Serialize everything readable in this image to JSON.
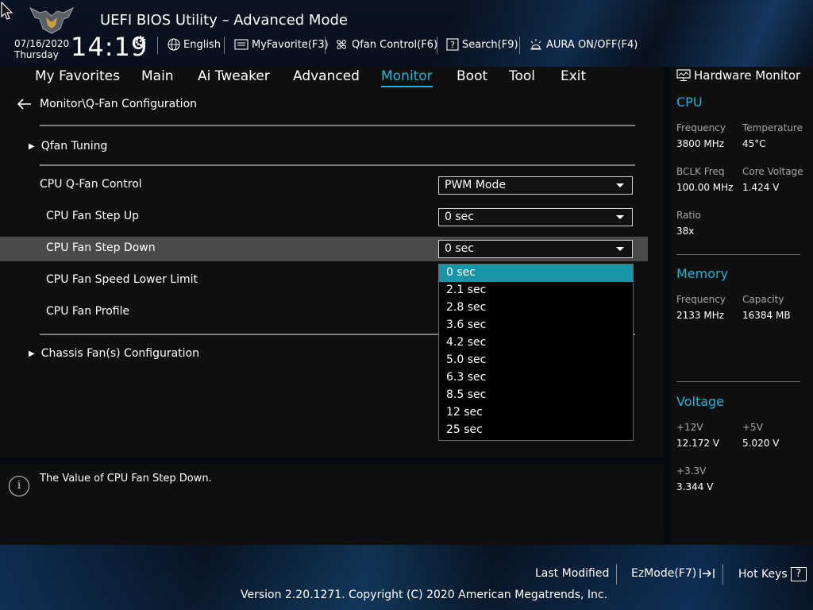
{
  "header": {
    "title": "UEFI BIOS Utility – Advanced Mode",
    "date": "07/16/2020",
    "day": "Thursday",
    "time": "14:19",
    "toolbar": [
      {
        "label": "English",
        "icon": "globe-icon"
      },
      {
        "label": "MyFavorite(F3)",
        "icon": "favorite-icon"
      },
      {
        "label": "Qfan Control(F6)",
        "icon": "fan-icon"
      },
      {
        "label": "Search(F9)",
        "icon": "search-icon"
      },
      {
        "label": "AURA ON/OFF(F4)",
        "icon": "aura-icon"
      }
    ]
  },
  "menu": {
    "items": [
      "My Favorites",
      "Main",
      "Ai Tweaker",
      "Advanced",
      "Monitor",
      "Boot",
      "Tool",
      "Exit"
    ],
    "active": "Monitor"
  },
  "content": {
    "breadcrumb": "Monitor\\Q-Fan Configuration",
    "qfan_tuning": "Qfan Tuning",
    "settings": [
      {
        "label": "CPU Q-Fan Control",
        "value": "PWM Mode"
      },
      {
        "label": "CPU Fan Step Up",
        "value": "0 sec"
      },
      {
        "label": "CPU Fan Step Down",
        "value": "0 sec"
      },
      {
        "label": "CPU Fan Speed Lower Limit",
        "value": ""
      },
      {
        "label": "CPU Fan Profile",
        "value": ""
      }
    ],
    "chassis": "Chassis Fan(s) Configuration",
    "dropdown_options": [
      "0 sec",
      "2.1 sec",
      "2.8 sec",
      "3.6 sec",
      "4.2 sec",
      "5.0 sec",
      "6.3 sec",
      "8.5 sec",
      "12 sec",
      "25 sec"
    ],
    "dropdown_selected": "0 sec"
  },
  "help": {
    "text": "The Value of CPU Fan Step Down."
  },
  "hardware_monitor": {
    "title": "Hardware Monitor",
    "cpu": {
      "heading": "CPU",
      "frequency_label": "Frequency",
      "frequency": "3800 MHz",
      "temperature_label": "Temperature",
      "temperature": "45°C",
      "bclk_label": "BCLK Freq",
      "bclk": "100.00 MHz",
      "core_voltage_label": "Core Voltage",
      "core_voltage": "1.424 V",
      "ratio_label": "Ratio",
      "ratio": "38x"
    },
    "memory": {
      "heading": "Memory",
      "frequency_label": "Frequency",
      "frequency": "2133 MHz",
      "capacity_label": "Capacity",
      "capacity": "16384 MB"
    },
    "voltage": {
      "heading": "Voltage",
      "v12_label": "+12V",
      "v12": "12.172 V",
      "v5_label": "+5V",
      "v5": "5.020 V",
      "v33_label": "+3.3V",
      "v33": "3.344 V"
    }
  },
  "footer": {
    "last_modified": "Last Modified",
    "ezmode": "EzMode(F7)",
    "hotkeys": "Hot Keys",
    "hotkeys_key": "?",
    "copyright": "Version 2.20.1271. Copyright (C) 2020 American Megatrends, Inc."
  },
  "colors": {
    "accent": "#19b6d8",
    "selection": "#1895a7",
    "panel": "#0f0f10",
    "row_highlight": "#4a4a4a"
  }
}
